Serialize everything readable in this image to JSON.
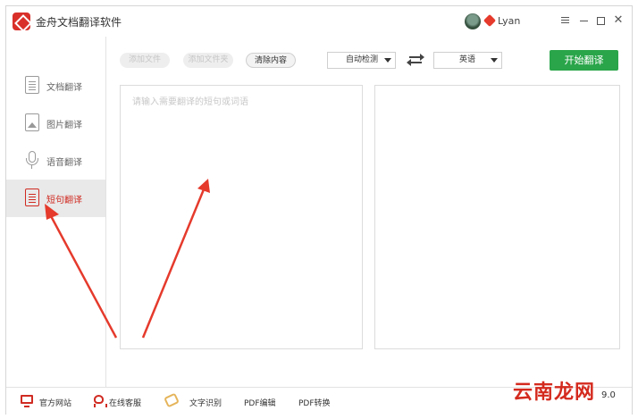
{
  "app": {
    "title": "金舟文档翻译软件",
    "user_name": "Lyan"
  },
  "sidebar": {
    "items": [
      {
        "label": "文档翻译",
        "icon": "document-icon",
        "active": false
      },
      {
        "label": "图片翻译",
        "icon": "image-icon",
        "active": false
      },
      {
        "label": "语音翻译",
        "icon": "microphone-icon",
        "active": false
      },
      {
        "label": "短句翻译",
        "icon": "sentence-icon",
        "active": true
      }
    ]
  },
  "toolbar": {
    "add_file": "添加文件",
    "add_folder": "添加文件夹",
    "clear": "清除内容",
    "source_lang": "自动检测",
    "target_lang": "英语",
    "start": "开始翻译"
  },
  "input": {
    "placeholder": "请输入需要翻译的短句或词语"
  },
  "footer": {
    "items": [
      "官方网站",
      "在线客服",
      "文字识别",
      "PDF编辑",
      "PDF转换"
    ],
    "version": "9.0",
    "watermark": "云南龙网"
  },
  "colors": {
    "accent": "#d02b22",
    "start_button": "#2aa54a",
    "arrow": "#e53a2c"
  }
}
